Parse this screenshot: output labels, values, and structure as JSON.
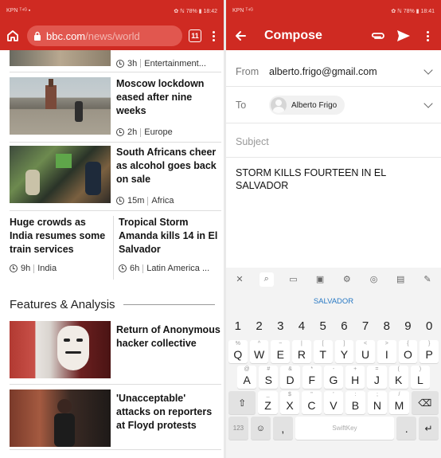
{
  "left": {
    "status": {
      "left": "KPN ᵀ⁴ᴳ ▪",
      "right": "✿ ℕ 78% ▮ 18:42"
    },
    "address": {
      "host": "bbc.com",
      "path": "/news/world",
      "tabs": "11"
    },
    "top_meta": {
      "time": "3h",
      "category": "Entertainment..."
    },
    "stories": [
      {
        "headline": "Moscow lockdown eased after nine weeks",
        "time": "2h",
        "category": "Europe"
      },
      {
        "headline": "South Africans cheer as alcohol goes back on sale",
        "time": "15m",
        "category": "Africa"
      }
    ],
    "split": [
      {
        "headline": "Huge crowds as India resumes some train services",
        "time": "9h",
        "category": "India"
      },
      {
        "headline": "Tropical Storm Amanda kills 14 in El Salvador",
        "time": "6h",
        "category": "Latin America ..."
      }
    ],
    "section_title": "Features & Analysis",
    "features": [
      {
        "headline": "Return of Anonymous hacker collective"
      },
      {
        "headline": "'Unacceptable' attacks on reporters at Floyd protests"
      }
    ]
  },
  "right": {
    "status": {
      "left": "KPN ᵀ⁴ᴳ",
      "right": "✿ ℕ 78% ▮ 18:41"
    },
    "title": "Compose",
    "from_label": "From",
    "from_value": "alberto.frigo@gmail.com",
    "to_label": "To",
    "to_chip": "Alberto Frigo",
    "subject_placeholder": "Subject",
    "body": "STORM KILLS FOURTEEN IN EL SALVADOR",
    "keyboard": {
      "suggestion": "SALVADOR",
      "numbers": [
        "1",
        "2",
        "3",
        "4",
        "5",
        "6",
        "7",
        "8",
        "9",
        "0"
      ],
      "row1": [
        [
          "Q",
          "%"
        ],
        [
          "W",
          "^"
        ],
        [
          "E",
          "~"
        ],
        [
          "R",
          "|"
        ],
        [
          "T",
          "["
        ],
        [
          "Y",
          "]"
        ],
        [
          "U",
          "<"
        ],
        [
          "I",
          ">"
        ],
        [
          "O",
          "{"
        ],
        [
          "P",
          "}"
        ]
      ],
      "row2": [
        [
          "A",
          "@"
        ],
        [
          "S",
          "#"
        ],
        [
          "D",
          "&"
        ],
        [
          "F",
          "*"
        ],
        [
          "G",
          "-"
        ],
        [
          "H",
          "+"
        ],
        [
          "J",
          "="
        ],
        [
          "K",
          "("
        ],
        [
          "L",
          ")"
        ]
      ],
      "row3": [
        [
          "Z",
          "_"
        ],
        [
          "X",
          "$"
        ],
        [
          "C",
          "\""
        ],
        [
          "V",
          "'"
        ],
        [
          "B",
          ":"
        ],
        [
          "N",
          ";"
        ],
        [
          "M",
          "/"
        ]
      ],
      "bottom": {
        "sym": "123",
        "comma": ",",
        "space": "SwiftKey",
        "period": "."
      }
    }
  },
  "colors": {
    "brand_red": "#cf2a22",
    "link_blue": "#2a7ac4"
  }
}
